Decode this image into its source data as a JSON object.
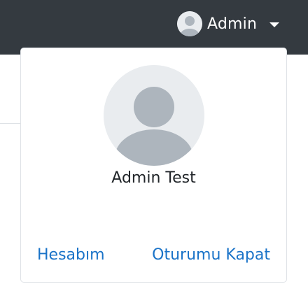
{
  "navbar": {
    "user_label": "Admin",
    "avatar_icon": "user-silhouette-icon",
    "caret_icon": "caret-down-icon",
    "background_color": "#343a40"
  },
  "user_panel": {
    "full_name": "Admin Test",
    "avatar_icon": "user-silhouette-icon",
    "account_link": "Hesabım",
    "logout_link": "Oturumu Kapat",
    "link_color": "#1a73c8"
  }
}
